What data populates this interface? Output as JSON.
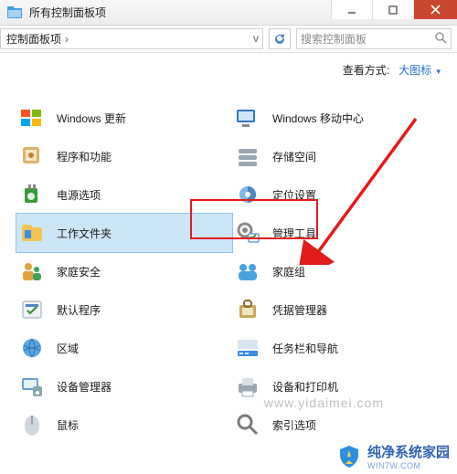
{
  "window": {
    "title": "所有控制面板项",
    "minimize_tip": "Minimize",
    "maximize_tip": "Maximize",
    "close_tip": "Close"
  },
  "addressbar": {
    "crumb": "控制面板项",
    "arrow_glyph": "›",
    "dropdown_glyph": "v",
    "refresh_tip": "刷新"
  },
  "search": {
    "placeholder": "搜索控制面板"
  },
  "viewrow": {
    "label": "查看方式:",
    "mode": "大图标",
    "tri": "▾"
  },
  "items": {
    "left": [
      {
        "key": "windows-update",
        "label": "Windows 更新"
      },
      {
        "key": "programs-features",
        "label": "程序和功能"
      },
      {
        "key": "power-options",
        "label": "电源选项"
      },
      {
        "key": "work-folders",
        "label": "工作文件夹",
        "selected": true
      },
      {
        "key": "family-safety",
        "label": "家庭安全"
      },
      {
        "key": "default-programs",
        "label": "默认程序"
      },
      {
        "key": "region",
        "label": "区域"
      },
      {
        "key": "device-manager",
        "label": "设备管理器"
      },
      {
        "key": "mouse",
        "label": "鼠标"
      }
    ],
    "right": [
      {
        "key": "mobility-center",
        "label": "Windows 移动中心"
      },
      {
        "key": "storage-spaces",
        "label": "存储空间"
      },
      {
        "key": "location-settings",
        "label": "定位设置"
      },
      {
        "key": "admin-tools",
        "label": "管理工具",
        "highlight": true
      },
      {
        "key": "homegroup",
        "label": "家庭组"
      },
      {
        "key": "credential-manager",
        "label": "凭据管理器"
      },
      {
        "key": "taskbar-navigation",
        "label": "任务栏和导航"
      },
      {
        "key": "devices-printers",
        "label": "设备和打印机"
      },
      {
        "key": "indexing-options",
        "label": "索引选项"
      }
    ]
  },
  "annotation": {
    "highlight_target": "admin-tools"
  },
  "watermark": {
    "url": "www.yidaimei.com",
    "brand": "纯净系统家园",
    "brand_sub": "WIN7W.COM"
  },
  "colors": {
    "highlight_red": "#e21b1b",
    "select_bg": "#cde6f7",
    "select_border": "#8cc5ee",
    "link_blue": "#1f6fd0"
  }
}
